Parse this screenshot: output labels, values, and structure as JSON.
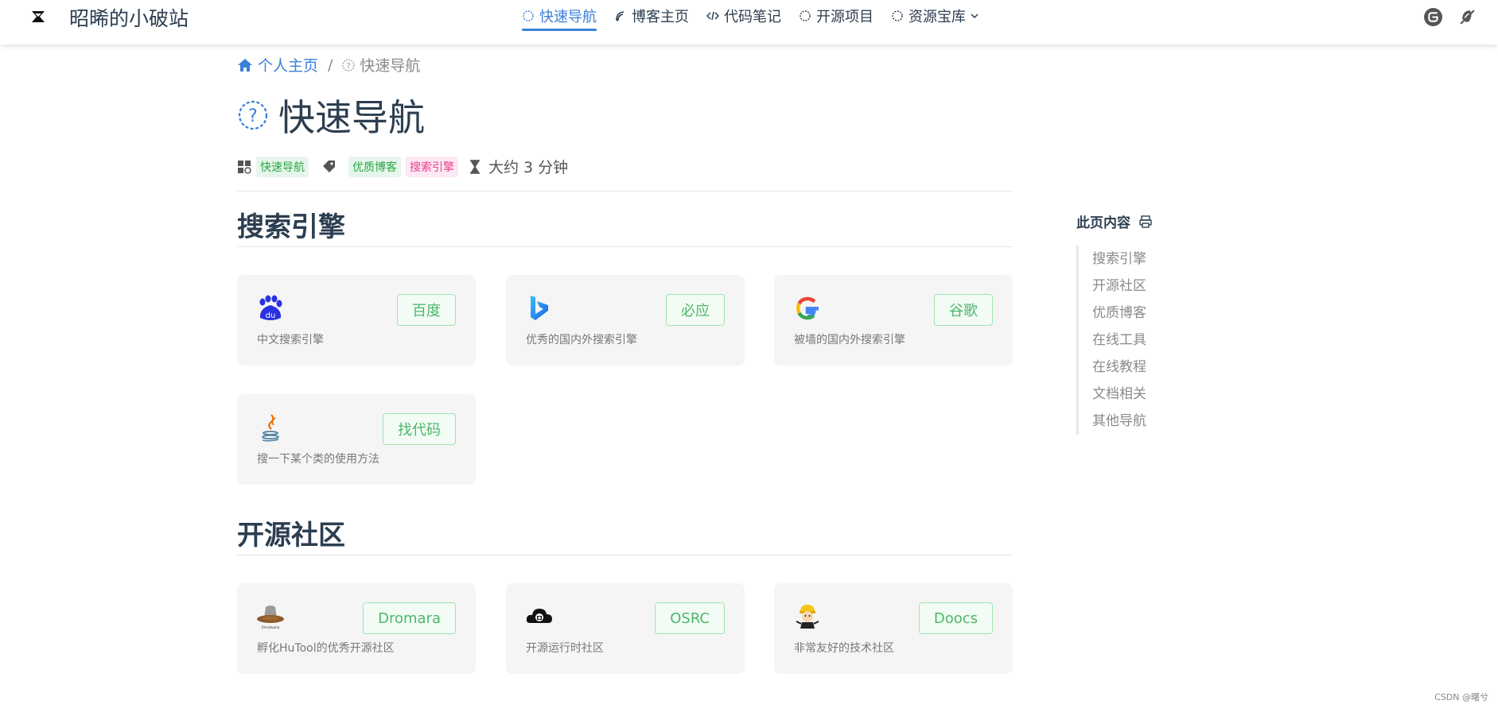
{
  "navbar": {
    "brand": "昭晞的小破站",
    "links": [
      {
        "label": "快速导航",
        "icon": "circle-icon"
      },
      {
        "label": "博客主页",
        "icon": "blog-icon"
      },
      {
        "label": "代码笔记",
        "icon": "code-icon"
      },
      {
        "label": "开源项目",
        "icon": "circle-icon"
      },
      {
        "label": "资源宝库",
        "icon": "circle-icon"
      }
    ],
    "right_icons": [
      "gitee-icon",
      "theme-toggle-icon"
    ]
  },
  "breadcrumb": {
    "home": "个人主页",
    "separator": "/",
    "current": "快速导航"
  },
  "page": {
    "title": "快速导航",
    "meta": {
      "category": "快速导航",
      "tags": [
        "优质博客",
        "搜索引擎"
      ],
      "read_time": "大约 3 分钟"
    }
  },
  "sections": [
    {
      "title": "搜索引擎",
      "cards": [
        {
          "button": "百度",
          "desc": "中文搜索引擎",
          "logo": "baidu-logo"
        },
        {
          "button": "必应",
          "desc": "优秀的国内外搜索引擎",
          "logo": "bing-logo"
        },
        {
          "button": "谷歌",
          "desc": "被墙的国内外搜索引擎",
          "logo": "google-logo"
        },
        {
          "button": "找代码",
          "desc": "搜一下某个类的使用方法",
          "logo": "java-logo"
        }
      ]
    },
    {
      "title": "开源社区",
      "cards": [
        {
          "button": "Dromara",
          "desc": "孵化HuTool的优秀开源社区",
          "logo": "dromara-logo"
        },
        {
          "button": "OSRC",
          "desc": "开源运行时社区",
          "logo": "osrc-logo"
        },
        {
          "button": "Doocs",
          "desc": "非常友好的技术社区",
          "logo": "doocs-logo"
        }
      ]
    }
  ],
  "toc": {
    "title": "此页内容",
    "items": [
      "搜索引擎",
      "开源社区",
      "优质博客",
      "在线工具",
      "在线教程",
      "文档相关",
      "其他导航"
    ]
  },
  "footer": "CSDN @曙兮",
  "colors": {
    "accent": "#3b7fd8",
    "button_green": "#4cb86a",
    "card_bg": "#f5f5f5"
  }
}
